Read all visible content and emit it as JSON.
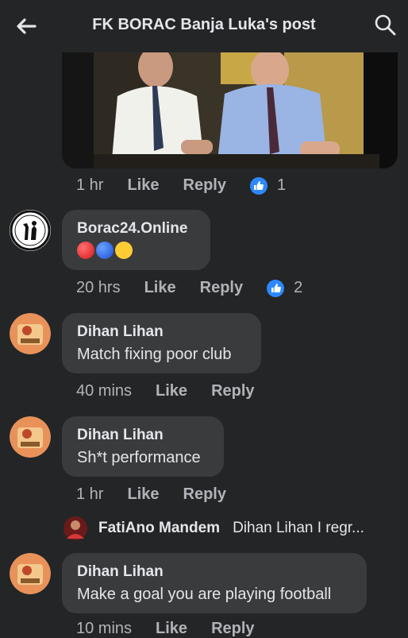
{
  "header": {
    "title": "FK BORAC Banja Luka's post"
  },
  "post_meta": {
    "time": "1 hr",
    "like": "Like",
    "reply": "Reply",
    "reactions": "1"
  },
  "comments": [
    {
      "author": "Borac24.Online",
      "text": "",
      "time": "20 hrs",
      "like": "Like",
      "reply": "Reply",
      "reactions": "2"
    },
    {
      "author": "Dihan Lihan",
      "text": "Match fixing poor club",
      "time": "40 mins",
      "like": "Like",
      "reply": "Reply"
    },
    {
      "author": "Dihan Lihan",
      "text": "Sh*t performance",
      "time": "1 hr",
      "like": "Like",
      "reply": "Reply"
    },
    {
      "author": "Dihan Lihan",
      "text": "Make a goal you are playing football",
      "time": "10 mins",
      "like": "Like",
      "reply": "Reply"
    }
  ],
  "reply_preview": {
    "author": "FatiAno Mandem",
    "text": "Dihan Lihan I regr..."
  },
  "colors": {
    "background": "#242526",
    "bubble": "#3a3b3c",
    "accent": "#2d88ff",
    "muted": "#b0b3b8"
  },
  "icons": {
    "back": "back-arrow-icon",
    "search": "search-icon",
    "like": "like-icon"
  }
}
